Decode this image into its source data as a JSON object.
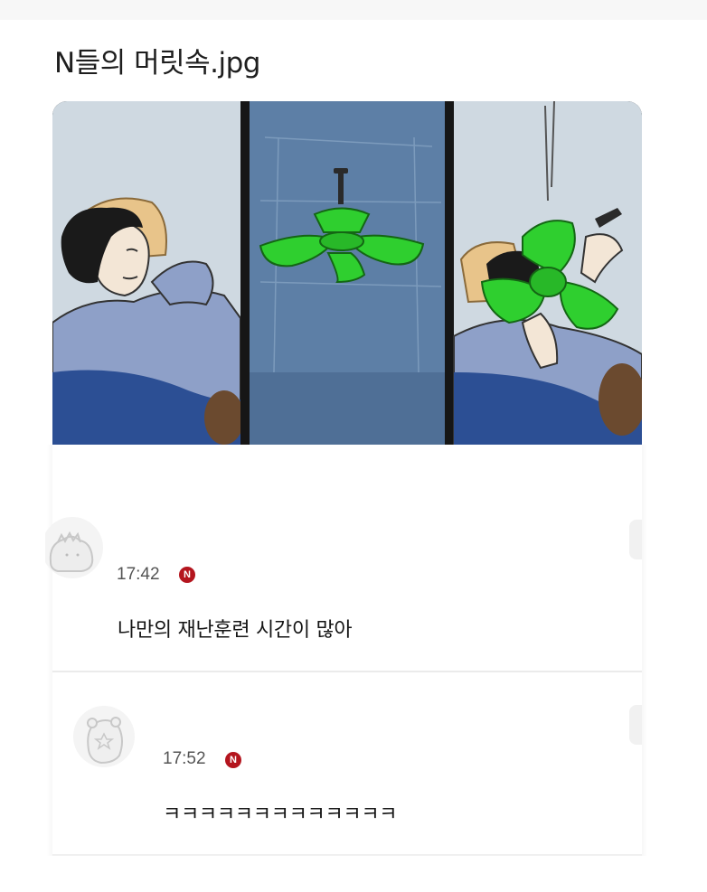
{
  "post": {
    "title": "N들의 머릿속.jpg"
  },
  "comic": {
    "panel_1": "person-lying-looking-up",
    "panel_2": "ceiling-fan",
    "panel_3": "fan-falling-on-person",
    "fan_color": "#2fcf2f"
  },
  "comments": [
    {
      "time": "17:42",
      "badge": "N",
      "text": "나만의 재난훈련 시간이 많아"
    },
    {
      "time": "17:52",
      "badge": "N",
      "text": "ㅋㅋㅋㅋㅋㅋㅋㅋㅋㅋㅋㅋㅋ"
    }
  ],
  "colors": {
    "badge": "#b4151e",
    "background": "#ffffff"
  }
}
